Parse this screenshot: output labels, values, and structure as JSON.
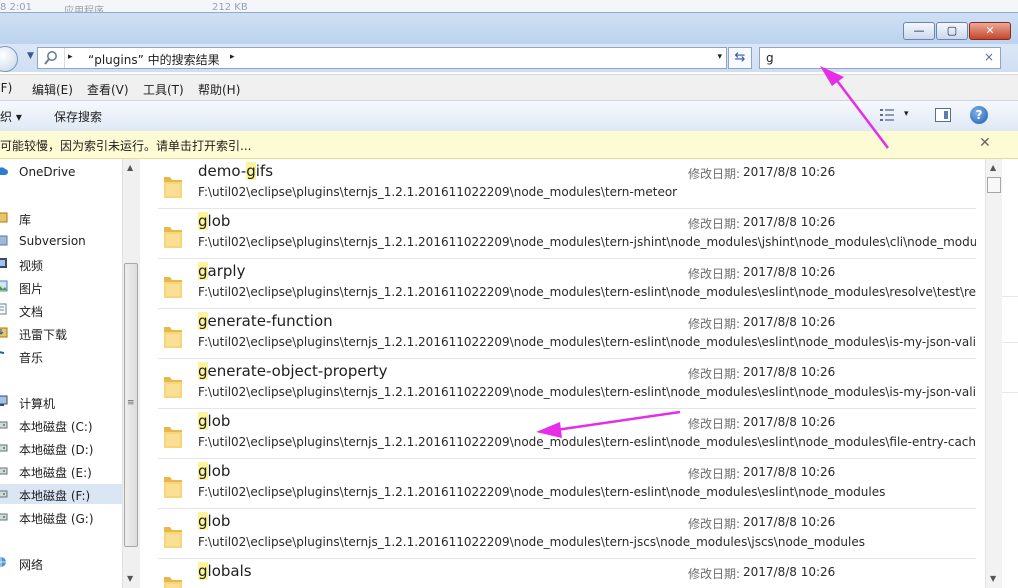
{
  "background_window": {
    "fragment_1": "8 2:01",
    "fragment_2": "应用程序",
    "fragment_3": "212 KB"
  },
  "window_controls": {
    "minimize": "—",
    "maximize": "▢",
    "close": "✕"
  },
  "address_bar": {
    "text": "“plugins” 中的搜索结果",
    "separator": "▸",
    "dropdown": "▾",
    "refresh_icon": "refresh-icon"
  },
  "search": {
    "value": "g",
    "clear": "×"
  },
  "menu": {
    "file": "(F)",
    "edit": "编辑(E)",
    "view": "查看(V)",
    "tools": "工具(T)",
    "help": "帮助(H)"
  },
  "toolbar": {
    "organize": "织 ▾",
    "save_search": "保存搜索",
    "help_symbol": "?",
    "view_dropdown": "▾"
  },
  "infobar": {
    "text": "可能较慢，因为索引未运行。请单击打开索引...",
    "close": "✕"
  },
  "nav": {
    "items": [
      {
        "label": "OneDrive",
        "icon": "cloud-icon"
      },
      {
        "label": "库",
        "icon": "library-icon"
      },
      {
        "label": "Subversion",
        "icon": "library-folder-icon"
      },
      {
        "label": "视频",
        "icon": "video-icon"
      },
      {
        "label": "图片",
        "icon": "picture-icon"
      },
      {
        "label": "文档",
        "icon": "document-icon"
      },
      {
        "label": "迅雷下载",
        "icon": "download-icon"
      },
      {
        "label": "音乐",
        "icon": "music-icon"
      },
      {
        "label": "计算机",
        "icon": "computer-icon"
      },
      {
        "label": "本地磁盘 (C:)",
        "icon": "drive-icon"
      },
      {
        "label": "本地磁盘 (D:)",
        "icon": "drive-icon"
      },
      {
        "label": "本地磁盘 (E:)",
        "icon": "drive-icon"
      },
      {
        "label": "本地磁盘 (F:)",
        "icon": "drive-icon",
        "selected": true
      },
      {
        "label": "本地磁盘 (G:)",
        "icon": "drive-icon"
      },
      {
        "label": "网络",
        "icon": "network-icon"
      }
    ],
    "scroll_up": "▲",
    "scroll_down": "▼",
    "scroll_grip": "≡"
  },
  "results": {
    "date_label": "修改日期:",
    "items": [
      {
        "pre": "demo-",
        "hl": "g",
        "post": "ifs",
        "path": "F:\\util02\\eclipse\\plugins\\ternjs_1.2.1.201611022209\\node_modules\\tern-meteor",
        "date": "2017/8/8 10:26"
      },
      {
        "pre": "",
        "hl": "g",
        "post": "lob",
        "path": "F:\\util02\\eclipse\\plugins\\ternjs_1.2.1.201611022209\\node_modules\\tern-jshint\\node_modules\\jshint\\node_modules\\cli\\node_modules",
        "date": "2017/8/8 10:26"
      },
      {
        "pre": "",
        "hl": "g",
        "post": "arply",
        "path": "F:\\util02\\eclipse\\plugins\\ternjs_1.2.1.201611022209\\node_modules\\tern-eslint\\node_modules\\eslint\\node_modules\\resolve\\test\\reso...",
        "date": "2017/8/8 10:26"
      },
      {
        "pre": "",
        "hl": "g",
        "post": "enerate-function",
        "path": "F:\\util02\\eclipse\\plugins\\ternjs_1.2.1.201611022209\\node_modules\\tern-eslint\\node_modules\\eslint\\node_modules\\is-my-json-valid\\...",
        "date": "2017/8/8 10:26"
      },
      {
        "pre": "",
        "hl": "g",
        "post": "enerate-object-property",
        "path": "F:\\util02\\eclipse\\plugins\\ternjs_1.2.1.201611022209\\node_modules\\tern-eslint\\node_modules\\eslint\\node_modules\\is-my-json-valid\\...",
        "date": "2017/8/8 10:26"
      },
      {
        "pre": "",
        "hl": "g",
        "post": "lob",
        "path": "F:\\util02\\eclipse\\plugins\\ternjs_1.2.1.201611022209\\node_modules\\tern-eslint\\node_modules\\eslint\\node_modules\\file-entry-cache\\...",
        "date": "2017/8/8 10:26"
      },
      {
        "pre": "",
        "hl": "g",
        "post": "lob",
        "path": "F:\\util02\\eclipse\\plugins\\ternjs_1.2.1.201611022209\\node_modules\\tern-eslint\\node_modules\\eslint\\node_modules",
        "date": "2017/8/8 10:26"
      },
      {
        "pre": "",
        "hl": "g",
        "post": "lob",
        "path": "F:\\util02\\eclipse\\plugins\\ternjs_1.2.1.201611022209\\node_modules\\tern-jscs\\node_modules\\jscs\\node_modules",
        "date": "2017/8/8 10:26"
      },
      {
        "pre": "",
        "hl": "g",
        "post": "lobals",
        "path": "",
        "date": "2017/8/8 10:26"
      }
    ],
    "scroll_up": "▲",
    "scroll_down": "▼"
  },
  "colors": {
    "annotation_arrow": "#e52ee5",
    "highlight": "#fbf49a",
    "infobar": "#fdfbd4"
  }
}
